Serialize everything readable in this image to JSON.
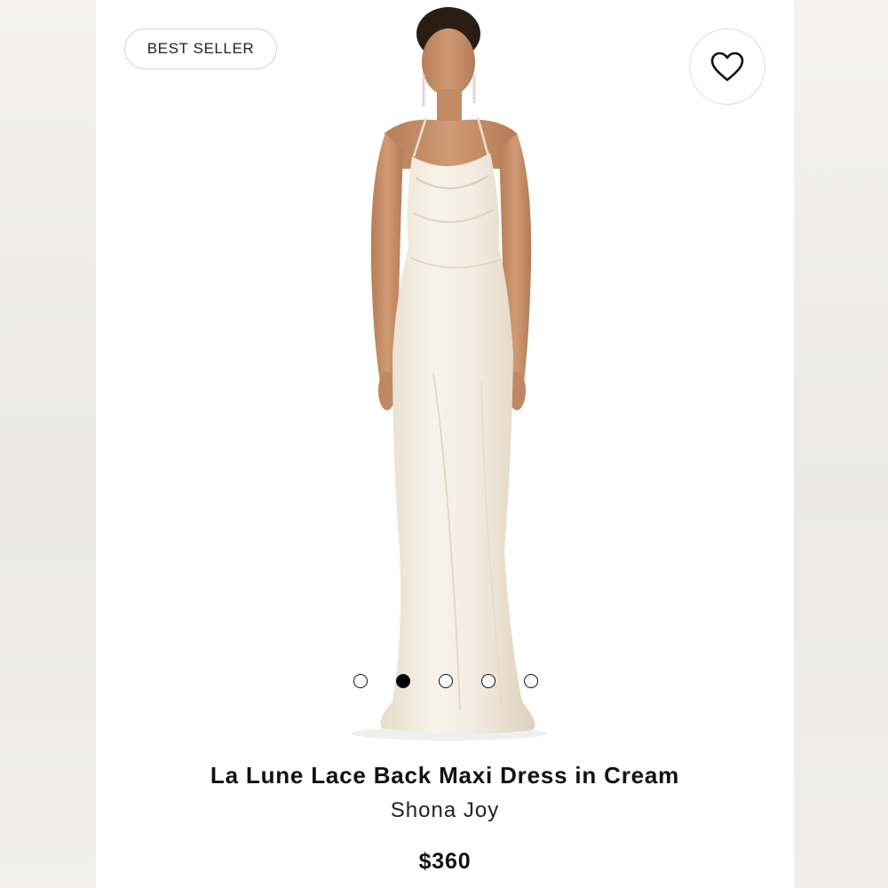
{
  "badge": {
    "label": "BEST SELLER"
  },
  "favorite": {
    "icon": "heart-outline-icon"
  },
  "product": {
    "title": "La Lune Lace Back Maxi Dress in Cream",
    "brand": "Shona Joy",
    "price": "$360"
  },
  "carousel": {
    "total": 5,
    "active_index": 1
  },
  "colors": {
    "dress": "#f3ece0",
    "skin": "#c8916a",
    "hair": "#2a1d16"
  }
}
